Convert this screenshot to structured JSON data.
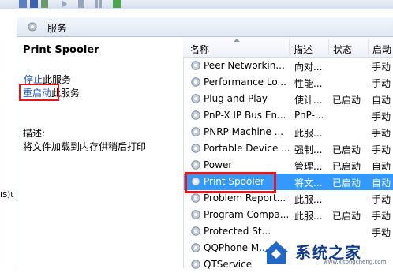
{
  "services_panel": {
    "title": "服务"
  },
  "detail": {
    "service_name": "Print Spooler",
    "stop_link": "停止",
    "stop_suffix": "此服务",
    "restart_link": "重启动",
    "restart_suffix": "此服务",
    "description_label": "描述:",
    "description_text": "将文件加载到内存供稍后打印"
  },
  "left_sliver_text": "IS)t",
  "table": {
    "columns": [
      "名称",
      "描述",
      "状态",
      "启动"
    ],
    "rows": [
      {
        "name": "Peer Networkin...",
        "desc": "向对...",
        "status": "",
        "startup": "手动",
        "selected": false
      },
      {
        "name": "Performance Lo...",
        "desc": "性能...",
        "status": "",
        "startup": "手动",
        "selected": false
      },
      {
        "name": "Plug and Play",
        "desc": "使计...",
        "status": "已启动",
        "startup": "自动",
        "selected": false
      },
      {
        "name": "PnP-X IP Bus En...",
        "desc": "PnP-...",
        "status": "",
        "startup": "手动",
        "selected": false
      },
      {
        "name": "PNRP Machine ...",
        "desc": "此服...",
        "status": "",
        "startup": "手动",
        "selected": false
      },
      {
        "name": "Portable Device ...",
        "desc": "强制...",
        "status": "已启动",
        "startup": "手动",
        "selected": false
      },
      {
        "name": "Power",
        "desc": "管理...",
        "status": "已启动",
        "startup": "自动",
        "selected": false
      },
      {
        "name": "Print Spooler",
        "desc": "将文...",
        "status": "已启动",
        "startup": "自动",
        "selected": true
      },
      {
        "name": "Problem Report...",
        "desc": "此服...",
        "status": "",
        "startup": "手动",
        "selected": false
      },
      {
        "name": "Program Compa...",
        "desc": "此服...",
        "status": "已启动",
        "startup": "手动",
        "selected": false
      },
      {
        "name": "Protected St...",
        "desc": "",
        "status": "",
        "startup": "手动",
        "selected": false
      },
      {
        "name": "QQPhone M...",
        "desc": "",
        "status": "",
        "startup": "",
        "selected": false
      },
      {
        "name": "QTService",
        "desc": "",
        "status": "",
        "startup": "",
        "selected": false
      }
    ]
  },
  "watermark": {
    "text": "系统之家",
    "sub": "www.xitongcheng.com"
  },
  "colors": {
    "selection": "#3399ff",
    "highlight_box": "#e2161b",
    "link": "#1a52b5"
  }
}
